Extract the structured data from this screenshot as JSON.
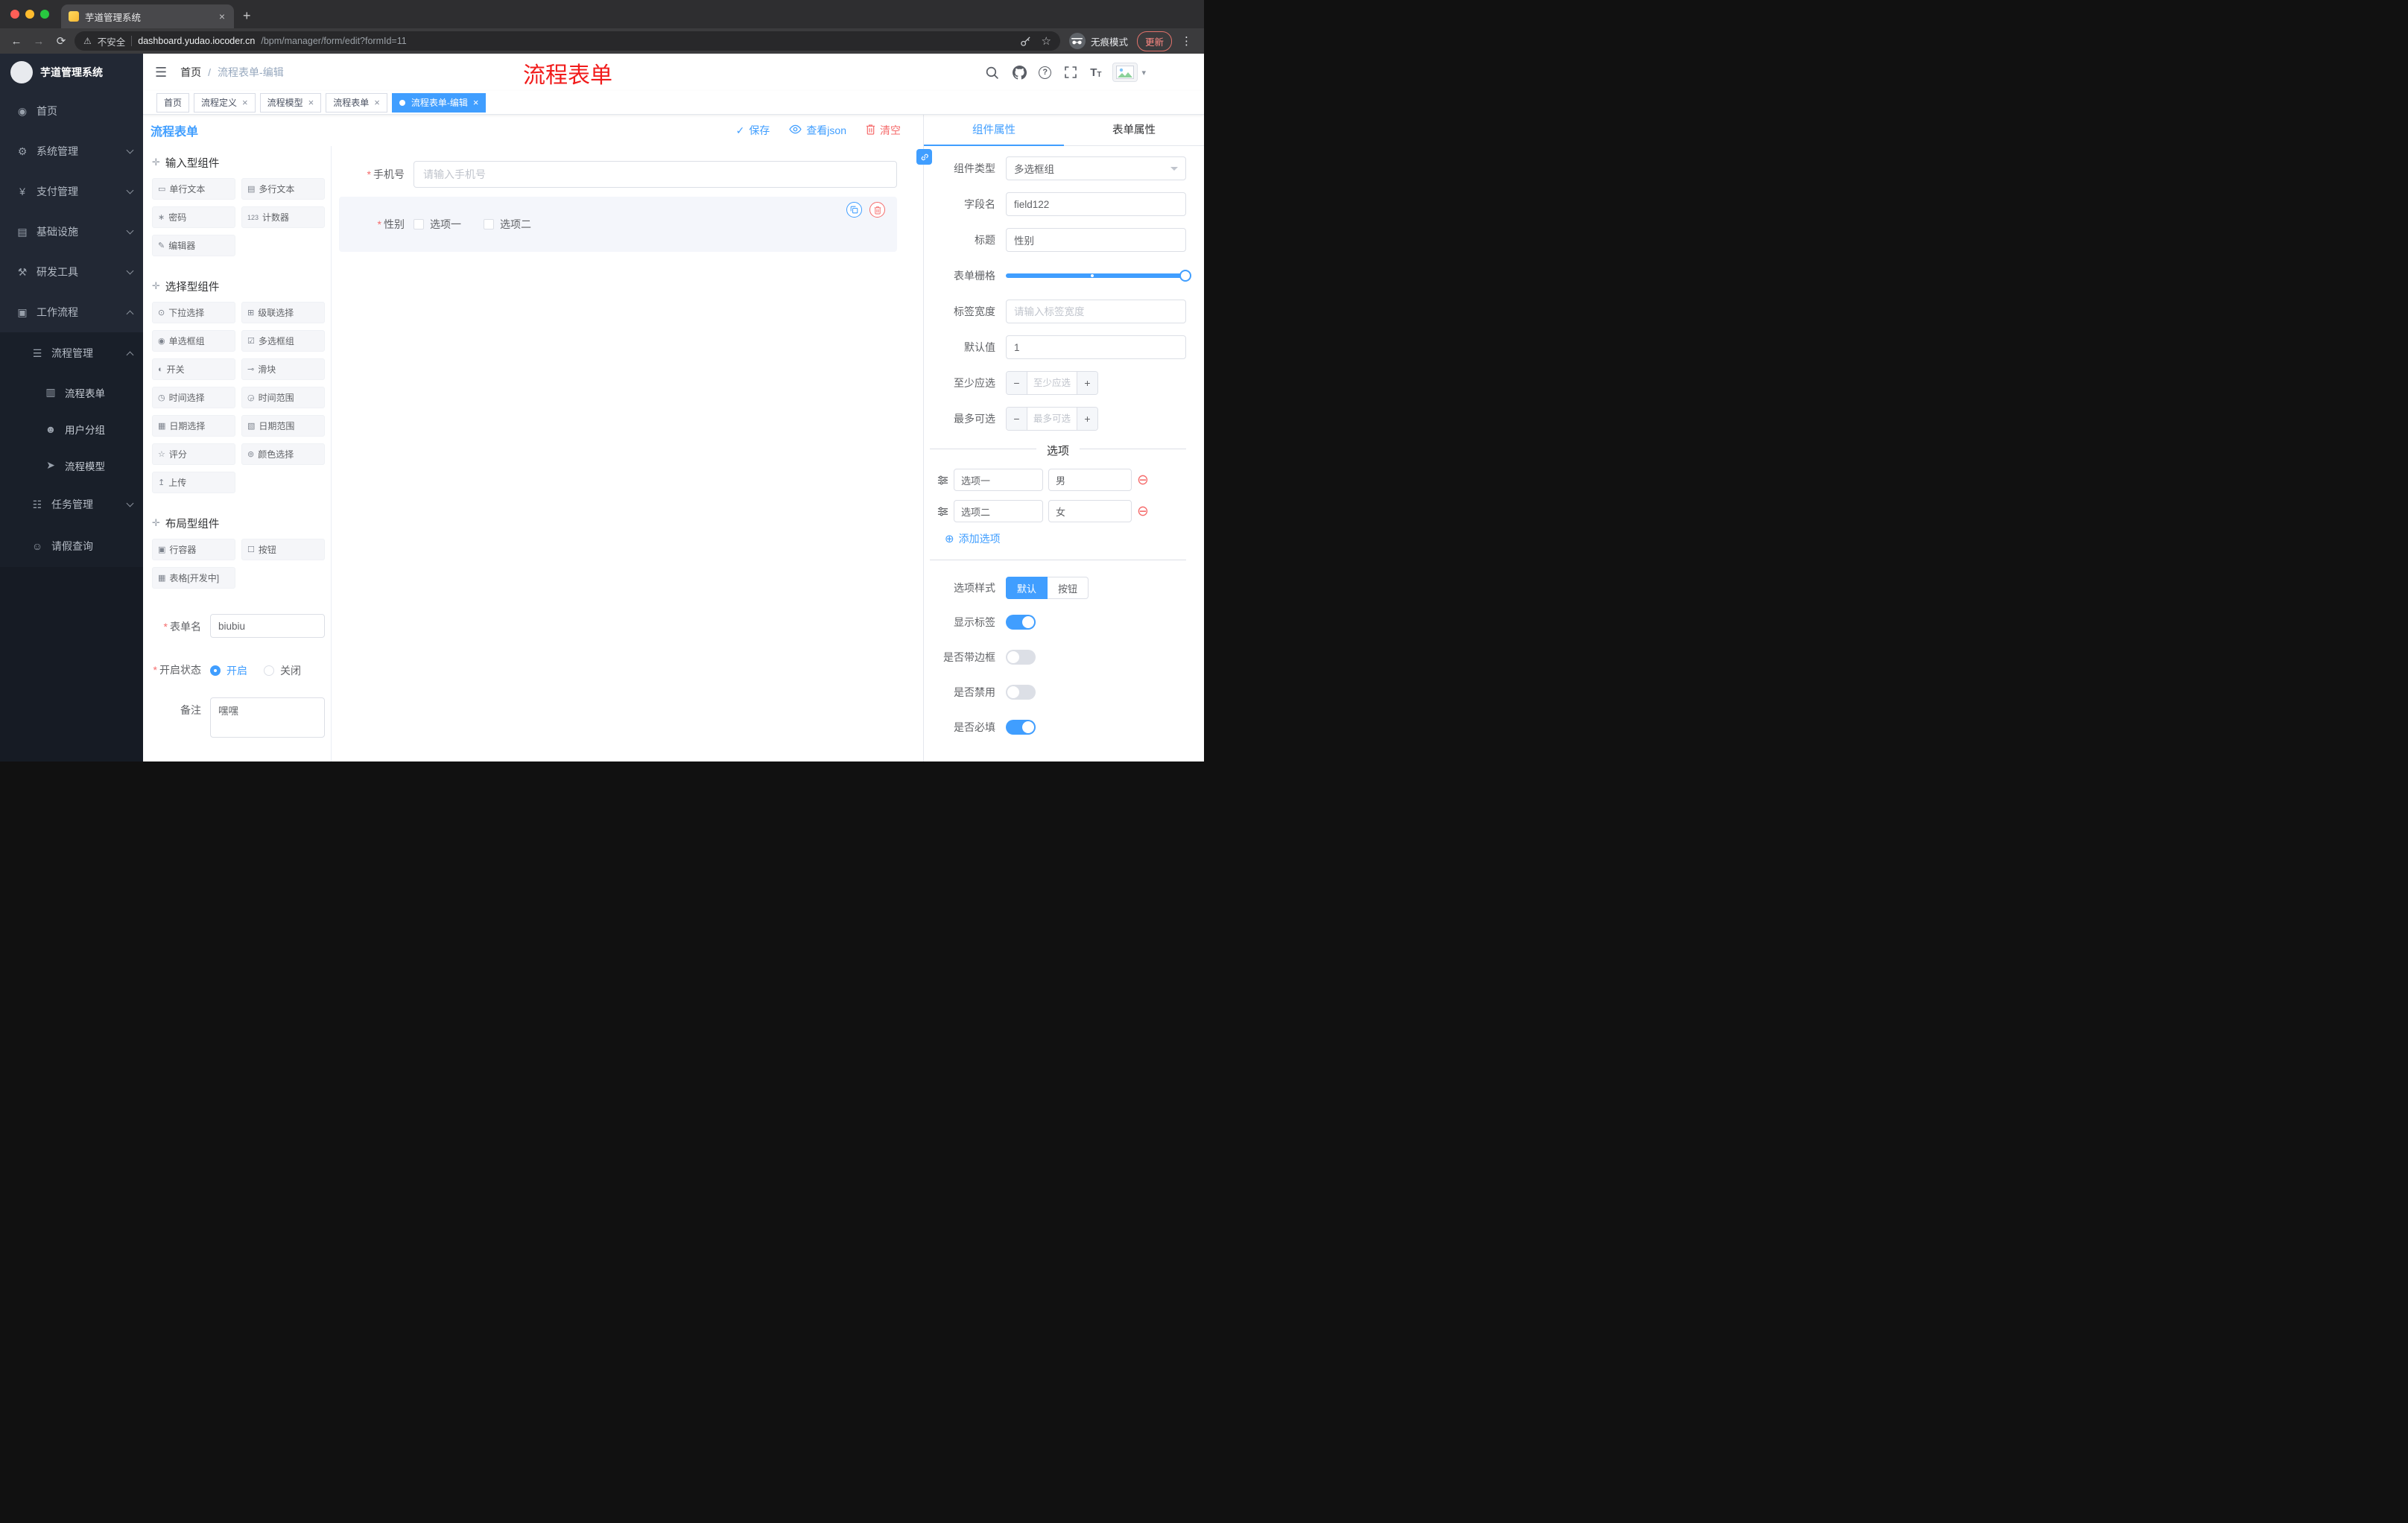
{
  "colors": {
    "accent": "#409eff",
    "danger": "#f56c6c",
    "annotation": "#f11b1b",
    "sidebar_bg": "#222834",
    "sidebar_sub_bg": "#191f29"
  },
  "icons": {
    "hamburger": "☰",
    "home": "◉",
    "gear": "⚙",
    "yen": "¥",
    "monitor": "▤",
    "tool": "⚒",
    "briefcase": "▣",
    "list": "☰",
    "document": "▥",
    "team": "☻",
    "send": "➤",
    "tree": "☷",
    "person": "☺",
    "drag": "✛",
    "check": "✓",
    "question": "?",
    "close": "×",
    "plus": "+",
    "minus": "−",
    "warning": "⚠",
    "star": "☆",
    "dots": "⋮",
    "caret": "▾",
    "back": "←",
    "forward": "→",
    "reload": "⟳",
    "slash": "/",
    "circle_plus": "⊕",
    "circle_minus": "⊖",
    "fontsize": "T",
    "comp_input": "▭",
    "comp_textarea": "▤",
    "comp_password": "∗",
    "comp_counter": "123",
    "comp_editor": "✎",
    "comp_select": "⊙",
    "comp_cascader": "⊞",
    "comp_radio": "◉",
    "comp_checkbox": "☑",
    "comp_switch": "◐",
    "comp_slider": "⊸",
    "comp_time": "◷",
    "comp_time_range": "◶",
    "comp_date": "▦",
    "comp_date_range": "▧",
    "comp_rate": "☆",
    "comp_color": "⊚",
    "comp_upload": "↥",
    "comp_row": "▣",
    "comp_button": "☐",
    "comp_table": "▦"
  },
  "browser": {
    "tab_title": "芋道管理系统",
    "security_label": "不安全",
    "url_host": "dashboard.yudao.iocoder.cn",
    "url_path": "/bpm/manager/form/edit?formId=11",
    "incognito_label": "无痕模式",
    "update_label": "更新"
  },
  "sidebar": {
    "logo_title": "芋道管理系统",
    "items": [
      {
        "label": "首页"
      },
      {
        "label": "系统管理"
      },
      {
        "label": "支付管理"
      },
      {
        "label": "基础设施"
      },
      {
        "label": "研发工具"
      },
      {
        "label": "工作流程"
      }
    ],
    "workflow": {
      "process_management": "流程管理",
      "process_children": [
        {
          "label": "流程表单"
        },
        {
          "label": "用户分组"
        },
        {
          "label": "流程模型"
        }
      ],
      "task_management": "任务管理",
      "leave_query": "请假查询"
    }
  },
  "header": {
    "breadcrumb_home": "首页",
    "breadcrumb_current": "流程表单-编辑",
    "annotation": "流程表单"
  },
  "tags": [
    {
      "label": "首页"
    },
    {
      "label": "流程定义"
    },
    {
      "label": "流程模型"
    },
    {
      "label": "流程表单"
    },
    {
      "label": "流程表单-编辑"
    }
  ],
  "toolbar": {
    "page_title": "流程表单",
    "save_label": "保存",
    "view_json_label": "查看json",
    "clear_label": "清空"
  },
  "palette": {
    "sections": [
      {
        "title": "输入型组件",
        "items": [
          {
            "label": "单行文本"
          },
          {
            "label": "多行文本"
          },
          {
            "label": "密码"
          },
          {
            "label": "计数器"
          },
          {
            "label": "编辑器"
          }
        ]
      },
      {
        "title": "选择型组件",
        "items": [
          {
            "label": "下拉选择"
          },
          {
            "label": "级联选择"
          },
          {
            "label": "单选框组"
          },
          {
            "label": "多选框组"
          },
          {
            "label": "开关"
          },
          {
            "label": "滑块"
          },
          {
            "label": "时间选择"
          },
          {
            "label": "时间范围"
          },
          {
            "label": "日期选择"
          },
          {
            "label": "日期范围"
          },
          {
            "label": "评分"
          },
          {
            "label": "颜色选择"
          },
          {
            "label": "上传"
          }
        ]
      },
      {
        "title": "布局型组件",
        "items": [
          {
            "label": "行容器"
          },
          {
            "label": "按钮"
          },
          {
            "label": "表格[开发中]"
          }
        ]
      }
    ]
  },
  "form_meta": {
    "name_label": "表单名",
    "name_value": "biubiu",
    "status_label": "开启状态",
    "status_on": "开启",
    "status_off": "关闭",
    "remark_label": "备注",
    "remark_value": "嘿嘿"
  },
  "canvas": {
    "phone_label": "手机号",
    "phone_placeholder": "请输入手机号",
    "gender_label": "性别",
    "gender_options": [
      {
        "label": "选项一"
      },
      {
        "label": "选项二"
      }
    ]
  },
  "props": {
    "tab_component": "组件属性",
    "tab_form": "表单属性",
    "rows": {
      "component_type_label": "组件类型",
      "component_type_value": "多选框组",
      "field_name_label": "字段名",
      "field_name_value": "field122",
      "title_label": "标题",
      "title_value": "性别",
      "grid_label": "表单栅格",
      "label_width_label": "标签宽度",
      "label_width_placeholder": "请输入标签宽度",
      "default_label": "默认值",
      "default_value": "1",
      "min_label": "至少应选",
      "min_placeholder": "至少应选",
      "max_label": "最多可选",
      "max_placeholder": "最多可选"
    },
    "options_title": "选项",
    "options": [
      {
        "label": "选项一",
        "value": "男"
      },
      {
        "label": "选项二",
        "value": "女"
      }
    ],
    "add_option_label": "添加选项",
    "option_style_label": "选项样式",
    "option_style_default": "默认",
    "option_style_button": "按钮",
    "switches": [
      {
        "label": "显示标签",
        "state": "on"
      },
      {
        "label": "是否带边框",
        "state": "off"
      },
      {
        "label": "是否禁用",
        "state": "off"
      },
      {
        "label": "是否必填",
        "state": "on"
      }
    ]
  }
}
